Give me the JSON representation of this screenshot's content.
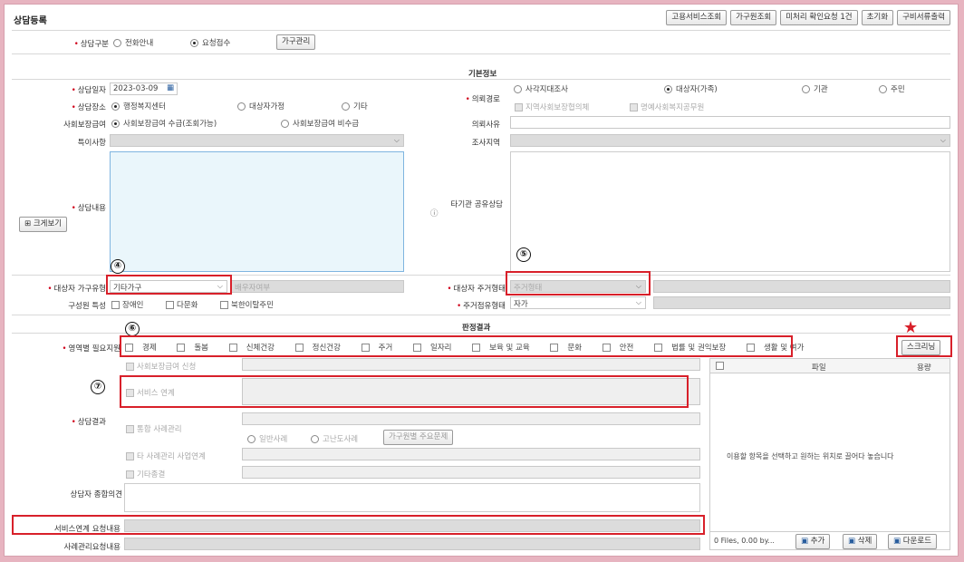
{
  "header": {
    "title": "상담등록",
    "buttons": [
      "고용서비스조회",
      "가구원조회",
      "미처리 확인요청 1건",
      "초기화",
      "구비서류출력"
    ]
  },
  "consult_type": {
    "label": "상담구분",
    "options": [
      "전화안내",
      "요청접수"
    ],
    "selected": "요청접수",
    "family_btn": "가구관리"
  },
  "basic_info": {
    "title": "기본정보"
  },
  "consult_date": {
    "label": "상담일자",
    "value": "2023-03-09"
  },
  "consult_place": {
    "label": "상담장소",
    "options": [
      "행정복지센터",
      "대상자가정",
      "기타"
    ]
  },
  "welfare_benefit": {
    "label": "사회보장급여",
    "options": [
      "사회보장급여 수급(조회가능)",
      "사회보장급여 비수급"
    ]
  },
  "special_notes": {
    "label": "특이사항"
  },
  "consult_content": {
    "label": "상담내용",
    "view_btn": "크게보기"
  },
  "request_path": {
    "label": "의뢰경로",
    "options": [
      "사각지대조사",
      "대상자(가족)",
      "기관",
      "주민"
    ],
    "sub_options": [
      "지역사회보장협의체",
      "명예사회복지공무원"
    ]
  },
  "request_reason": {
    "label": "의뢰사유"
  },
  "survey_area": {
    "label": "조사지역"
  },
  "other_agency": {
    "label": "타기관 공유상담"
  },
  "household_type": {
    "label": "대상자 가구유형",
    "value": "기타가구",
    "extra_placeholder": "배우자여부"
  },
  "member_traits": {
    "label": "구성원 특성",
    "options": [
      "장애인",
      "다문화",
      "북한이탈주민"
    ]
  },
  "residence_type": {
    "label": "대상자 주거형태",
    "placeholder": "주거형태"
  },
  "ownership_type": {
    "label": "주거점유형태",
    "value": "자가"
  },
  "result_section": {
    "title": "판정결과"
  },
  "needs": {
    "label": "영역별 필요지원",
    "options": [
      "경제",
      "돌봄",
      "신체건강",
      "정신건강",
      "주거",
      "일자리",
      "보육 및 교육",
      "문화",
      "안전",
      "법률 및 권익보장",
      "생활 및 여가"
    ],
    "screening_btn": "스크리닝"
  },
  "consult_result": {
    "label": "상담결과",
    "welfare_apply": "사회보장급여 신청",
    "service_link": "서비스 연계",
    "case_mgmt": "통합 사례관리",
    "case_types": [
      "일반사례",
      "고난도사례"
    ],
    "family_issue_btn": "가구원별 주요문제",
    "other_case": "타 사례관리 사업연계",
    "other_end": "기타종결"
  },
  "counselor_opinion": {
    "label": "상담자 종합의견"
  },
  "service_request": {
    "label": "서비스연계 요청내용"
  },
  "case_request": {
    "label": "사례관리요청내용"
  },
  "files": {
    "col_file": "파일",
    "col_size": "용량",
    "drop_text": "이용할 항목을 선택하고 원하는 위치로 끌어다 놓습니다",
    "status": "0 Files, 0.00 by...",
    "buttons": [
      "추가",
      "삭제",
      "다운로드"
    ]
  },
  "annotations": [
    "④",
    "⑤",
    "⑥",
    "⑦"
  ],
  "colors": {
    "highlight": "#d8202a",
    "required": "#d0021b",
    "textarea_bg": "#eaf6fb"
  }
}
